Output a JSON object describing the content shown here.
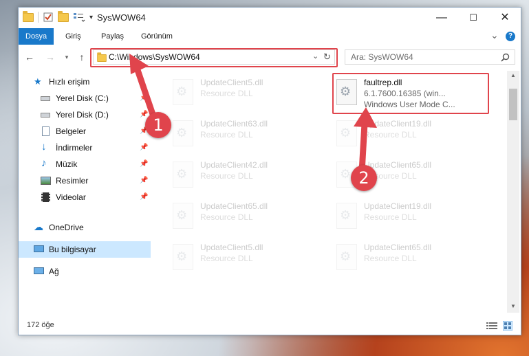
{
  "window": {
    "title": "SysWOW64",
    "controls": {
      "minimize": "—",
      "maximize": "☐",
      "close": "✕"
    }
  },
  "ribbon": {
    "tabs": [
      {
        "label": "Dosya",
        "active": true
      },
      {
        "label": "Giriş"
      },
      {
        "label": "Paylaş"
      },
      {
        "label": "Görünüm"
      }
    ],
    "expand": "⌄",
    "help": "?"
  },
  "address": {
    "path": "C:\\Windows\\SysWOW64",
    "search_placeholder": "Ara: SysWOW64"
  },
  "sidebar": {
    "quick_access": "Hızlı erişim",
    "items": [
      {
        "label": "Yerel Disk (C:)",
        "icon": "drive-icon"
      },
      {
        "label": "Yerel Disk (D:)",
        "icon": "drive-icon"
      },
      {
        "label": "Belgeler",
        "icon": "documents-icon"
      },
      {
        "label": "İndirmeler",
        "icon": "downloads-icon"
      },
      {
        "label": "Müzik",
        "icon": "music-icon"
      },
      {
        "label": "Resimler",
        "icon": "pictures-icon"
      },
      {
        "label": "Videolar",
        "icon": "videos-icon"
      }
    ],
    "onedrive": "OneDrive",
    "this_pc": "Bu bilgisayar",
    "network": "Ağ"
  },
  "files": {
    "highlighted": {
      "name": "faultrep.dll",
      "version": "6.1.7600.16385 (win...",
      "description": "Windows User Mode C..."
    },
    "left_column": [
      {
        "name": "UpdateClient5.dll",
        "type": "Resource DLL"
      },
      {
        "name": "UpdateClient63.dll",
        "type": "Resource DLL"
      },
      {
        "name": "UpdateClient42.dll",
        "type": "Resource DLL"
      },
      {
        "name": "UpdateClient65.dll",
        "type": "Resource DLL"
      },
      {
        "name": "UpdateClient5.dll",
        "type": "Resource DLL"
      }
    ],
    "right_column": [
      {
        "name": "UpdateClient19.dll",
        "type": "Resource DLL"
      },
      {
        "name": "UpdateClient65.dll",
        "type": "Resource DLL"
      },
      {
        "name": "UpdateClient19.dll",
        "type": "Resource DLL"
      },
      {
        "name": "UpdateClient65.dll",
        "type": "Resource DLL"
      }
    ]
  },
  "status": {
    "count": "172 öğe"
  },
  "annotations": {
    "step1": "1",
    "step2": "2"
  },
  "colors": {
    "accent": "#1979ca",
    "highlight_red": "#e0444c",
    "selected": "#cce8ff"
  }
}
